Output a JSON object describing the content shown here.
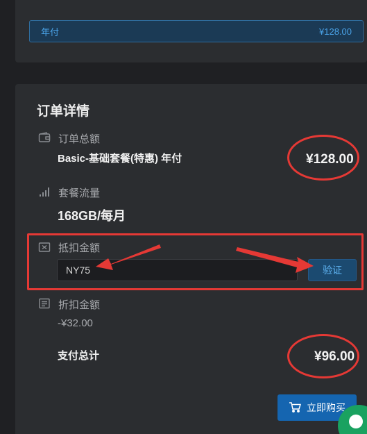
{
  "plan_option": {
    "label": "年付",
    "price": "¥128.00"
  },
  "order": {
    "title": "订单详情",
    "total_label": "订单总额",
    "plan_name": "Basic-基础套餐(特惠) 年付",
    "total_amount": "¥128.00",
    "traffic_label": "套餐流量",
    "traffic_value": "168GB/每月",
    "coupon_label": "抵扣金额",
    "coupon_code": "NY75",
    "verify_label": "验证",
    "discount_label": "折扣金额",
    "discount_value": "-¥32.00",
    "pay_total_label": "支付总计",
    "pay_total_amount": "¥96.00",
    "buy_label": "立即购买"
  },
  "icons": {
    "wallet": "wallet-icon",
    "signal": "signal-icon",
    "coupon": "coupon-icon",
    "receipt": "receipt-icon",
    "cart": "cart-icon"
  },
  "colors": {
    "accent": "#1565b0",
    "annotation": "#e53935",
    "chat": "#1aa260"
  }
}
